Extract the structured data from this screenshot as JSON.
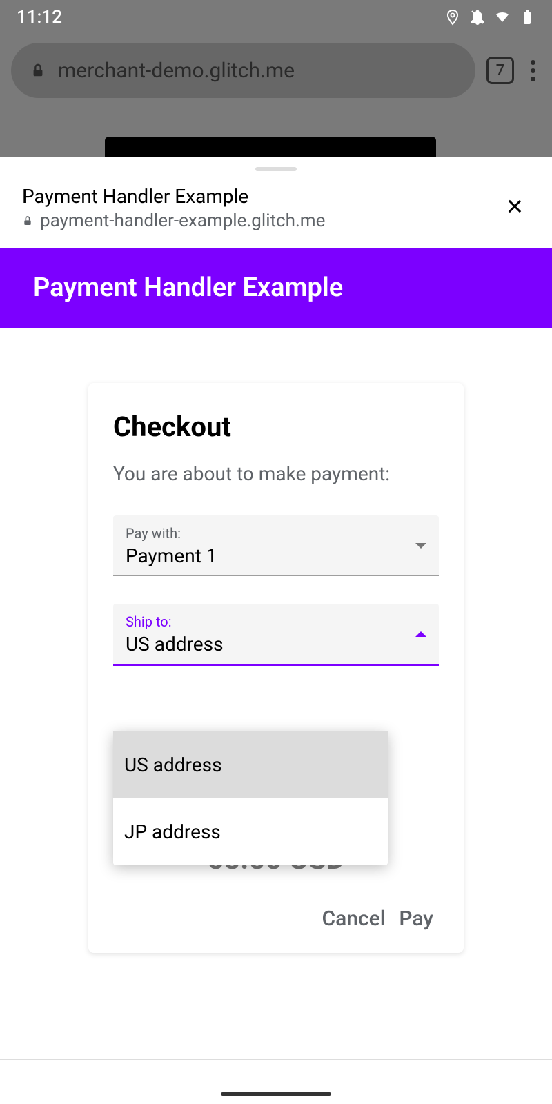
{
  "status": {
    "time": "11:12"
  },
  "browser": {
    "url": "merchant-demo.glitch.me",
    "tab_count": "7"
  },
  "sheet": {
    "title": "Payment Handler Example",
    "origin": "payment-handler-example.glitch.me",
    "banner": "Payment Handler Example"
  },
  "card": {
    "title": "Checkout",
    "subtitle": "You are about to make payment:",
    "pay_with": {
      "label": "Pay with:",
      "value": "Payment 1"
    },
    "ship_to": {
      "label": "Ship to:",
      "value": "US address",
      "options": [
        "US address",
        "JP address"
      ]
    },
    "amount": "65.00 USD",
    "cancel": "Cancel",
    "pay": "Pay"
  }
}
